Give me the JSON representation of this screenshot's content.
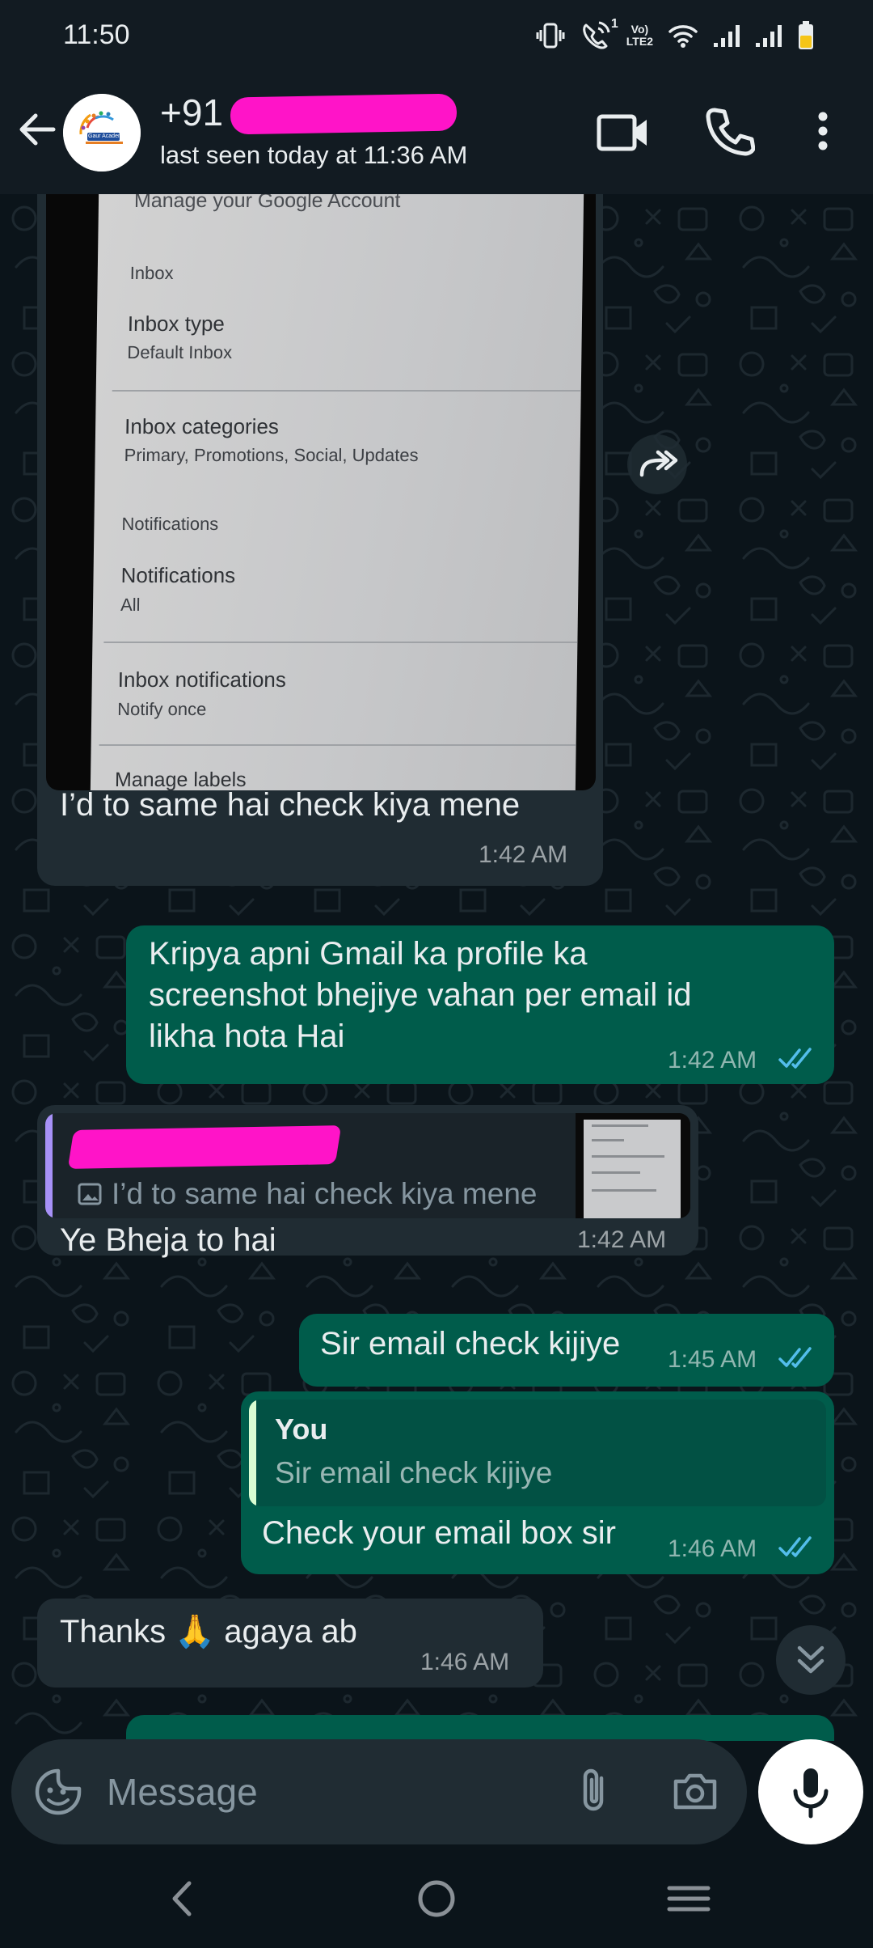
{
  "status_bar": {
    "time": "11:50",
    "volte_label": "Vo) LTE2",
    "sim_label": "1"
  },
  "header": {
    "contact_name": "+91",
    "last_seen": "last seen today at 11:36 AM",
    "avatar_text": "Gaur Academy of"
  },
  "screenshot": {
    "title": "Manage your Google Account",
    "inbox_header": "Inbox",
    "inbox_type_label": "Inbox type",
    "inbox_type_value": "Default Inbox",
    "inbox_categories_label": "Inbox categories",
    "inbox_categories_value": "Primary, Promotions, Social, Updates",
    "notifications_header": "Notifications",
    "notifications_label": "Notifications",
    "notifications_value": "All",
    "inbox_notifications_label": "Inbox notifications",
    "inbox_notifications_value": "Notify once",
    "manage_labels_label": "Manage labels"
  },
  "messages": [
    {
      "id": "m1",
      "direction": "in",
      "text": "I’d to same hai check kiya mene",
      "time": "1:42 AM"
    },
    {
      "id": "m2",
      "direction": "out",
      "lines": [
        "Kripya apni Gmail ka profile ka",
        "screenshot bhejiye vahan per email id",
        "likha hota Hai"
      ],
      "time": "1:42 AM",
      "status": "read"
    },
    {
      "id": "m3",
      "direction": "in",
      "quote_text": "I’d to same hai check kiya mene",
      "text": "Ye Bheja to hai",
      "time": "1:42 AM"
    },
    {
      "id": "m4",
      "direction": "out",
      "text": "Sir email check kijiye",
      "time": "1:45 AM",
      "status": "read"
    },
    {
      "id": "m5",
      "direction": "out",
      "quote_author": "You",
      "quote_text": "Sir email check kijiye",
      "text": "Check your email box sir",
      "time": "1:46 AM",
      "status": "read"
    },
    {
      "id": "m6",
      "direction": "in",
      "text_before": "Thanks",
      "emoji": "🙏",
      "text_after": "agaya ab",
      "time": "1:46 AM"
    }
  ],
  "composer": {
    "placeholder": "Message"
  },
  "colors": {
    "incoming_bubble": "#202c33",
    "outgoing_bubble": "#005c4b",
    "read_ticks": "#53bdeb",
    "quote_bar_in": "#a791f7",
    "quote_bar_out": "#d9fdd3",
    "redaction": "#ff14c8"
  }
}
